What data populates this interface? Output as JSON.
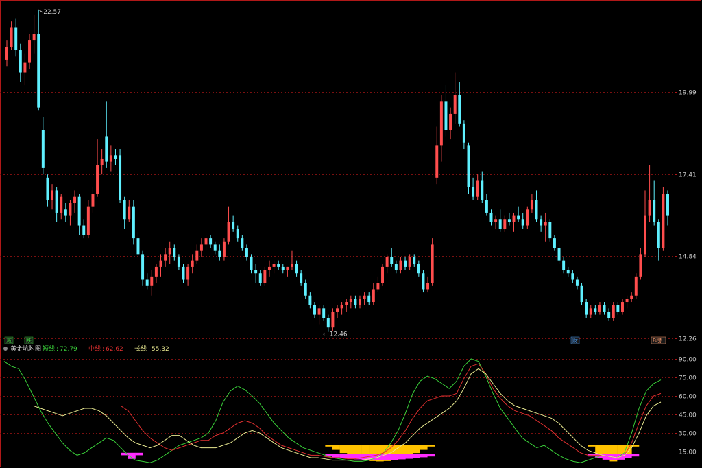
{
  "chart_data": [
    {
      "type": "candlestick",
      "title": "",
      "ylim": [
        12.26,
        22.57
      ],
      "y_ticks": [
        "19.99",
        "17.41",
        "14.84",
        "12.26"
      ],
      "max_label": "22.57",
      "min_label": "12.46",
      "event_marks": [
        "减",
        "跌",
        "财",
        "8榜"
      ],
      "colors": {
        "up": "#ff4d4d",
        "down": "#5ff0ff",
        "grid": "#7a1010",
        "axis": "#b01818"
      },
      "candles": [
        [
          21.0,
          21.6,
          20.8,
          21.4
        ],
        [
          21.4,
          22.2,
          21.3,
          22.0
        ],
        [
          22.0,
          22.3,
          21.1,
          21.3
        ],
        [
          21.3,
          21.5,
          20.3,
          20.6
        ],
        [
          20.6,
          21.2,
          20.2,
          20.9
        ],
        [
          20.9,
          21.8,
          20.7,
          21.6
        ],
        [
          21.6,
          22.4,
          21.2,
          21.8
        ],
        [
          21.8,
          22.57,
          19.4,
          19.5
        ],
        [
          18.8,
          19.2,
          17.4,
          17.6
        ],
        [
          17.3,
          17.4,
          16.4,
          16.6
        ],
        [
          16.6,
          17.1,
          16.3,
          16.9
        ],
        [
          16.9,
          17.0,
          15.9,
          16.2
        ],
        [
          16.2,
          16.8,
          16.0,
          16.7
        ],
        [
          16.3,
          16.5,
          15.9,
          16.1
        ],
        [
          16.1,
          16.6,
          15.8,
          16.5
        ],
        [
          16.5,
          16.9,
          16.2,
          16.7
        ],
        [
          16.7,
          16.8,
          15.5,
          15.8
        ],
        [
          15.8,
          16.0,
          15.4,
          15.5
        ],
        [
          15.5,
          16.6,
          15.4,
          16.4
        ],
        [
          16.4,
          17.0,
          16.2,
          16.8
        ],
        [
          16.8,
          18.5,
          16.7,
          17.7
        ],
        [
          17.7,
          18.2,
          17.4,
          17.9
        ],
        [
          18.6,
          19.7,
          17.6,
          17.8
        ],
        [
          17.8,
          18.3,
          17.5,
          18.0
        ],
        [
          18.0,
          18.2,
          17.7,
          17.9
        ],
        [
          18.0,
          18.2,
          16.5,
          16.6
        ],
        [
          16.6,
          16.7,
          15.7,
          16.0
        ],
        [
          16.0,
          16.6,
          15.9,
          16.4
        ],
        [
          16.4,
          16.6,
          15.2,
          15.4
        ],
        [
          15.4,
          15.6,
          14.8,
          14.9
        ],
        [
          14.9,
          15.0,
          13.9,
          14.1
        ],
        [
          14.1,
          14.3,
          13.8,
          13.9
        ],
        [
          13.9,
          14.4,
          13.6,
          14.2
        ],
        [
          14.2,
          14.6,
          14.0,
          14.5
        ],
        [
          14.5,
          14.9,
          14.2,
          14.7
        ],
        [
          14.7,
          15.1,
          14.5,
          14.9
        ],
        [
          14.9,
          15.3,
          14.6,
          15.1
        ],
        [
          15.1,
          15.2,
          14.7,
          14.8
        ],
        [
          14.8,
          14.9,
          14.4,
          14.5
        ],
        [
          14.5,
          14.6,
          14.0,
          14.1
        ],
        [
          14.1,
          14.6,
          13.9,
          14.5
        ],
        [
          14.5,
          14.9,
          14.3,
          14.7
        ],
        [
          14.7,
          15.2,
          14.6,
          15.0
        ],
        [
          15.0,
          15.4,
          14.8,
          15.2
        ],
        [
          15.2,
          15.5,
          15.0,
          15.4
        ],
        [
          15.4,
          15.5,
          15.1,
          15.2
        ],
        [
          15.2,
          15.3,
          14.9,
          15.0
        ],
        [
          15.0,
          15.2,
          14.7,
          14.8
        ],
        [
          14.8,
          15.4,
          14.7,
          15.3
        ],
        [
          15.3,
          16.4,
          15.2,
          15.9
        ],
        [
          15.9,
          16.1,
          15.6,
          15.7
        ],
        [
          15.7,
          15.8,
          15.3,
          15.4
        ],
        [
          15.4,
          15.5,
          15.0,
          15.1
        ],
        [
          15.1,
          15.2,
          14.7,
          14.8
        ],
        [
          14.8,
          14.9,
          14.3,
          14.4
        ],
        [
          14.4,
          14.6,
          14.0,
          14.3
        ],
        [
          14.3,
          14.4,
          13.9,
          14.0
        ],
        [
          14.0,
          14.5,
          13.9,
          14.4
        ],
        [
          14.4,
          14.7,
          14.2,
          14.5
        ],
        [
          14.5,
          14.7,
          14.3,
          14.6
        ],
        [
          14.6,
          14.7,
          14.4,
          14.5
        ],
        [
          14.5,
          14.6,
          14.3,
          14.4
        ],
        [
          14.4,
          14.5,
          14.2,
          14.5
        ],
        [
          14.5,
          15.0,
          14.4,
          14.6
        ],
        [
          14.6,
          14.7,
          14.2,
          14.3
        ],
        [
          14.3,
          14.4,
          13.9,
          14.0
        ],
        [
          14.0,
          14.1,
          13.5,
          13.6
        ],
        [
          13.6,
          13.7,
          13.2,
          13.3
        ],
        [
          13.3,
          13.4,
          12.9,
          13.0
        ],
        [
          13.0,
          13.3,
          12.7,
          13.2
        ],
        [
          13.2,
          13.3,
          12.8,
          12.9
        ],
        [
          12.9,
          13.0,
          12.46,
          12.6
        ],
        [
          12.6,
          13.2,
          12.5,
          13.1
        ],
        [
          13.1,
          13.3,
          12.9,
          13.2
        ],
        [
          13.2,
          13.4,
          13.0,
          13.3
        ],
        [
          13.3,
          13.5,
          13.1,
          13.4
        ],
        [
          13.4,
          13.6,
          13.2,
          13.5
        ],
        [
          13.5,
          13.6,
          13.2,
          13.3
        ],
        [
          13.3,
          13.6,
          13.2,
          13.5
        ],
        [
          13.5,
          13.7,
          13.3,
          13.6
        ],
        [
          13.6,
          13.7,
          13.3,
          13.4
        ],
        [
          13.4,
          14.0,
          13.3,
          13.8
        ],
        [
          13.8,
          14.2,
          13.7,
          14.0
        ],
        [
          14.0,
          14.6,
          13.9,
          14.5
        ],
        [
          14.5,
          14.9,
          14.3,
          14.8
        ],
        [
          14.8,
          15.1,
          14.5,
          14.6
        ],
        [
          14.6,
          14.7,
          14.3,
          14.4
        ],
        [
          14.4,
          14.8,
          14.3,
          14.7
        ],
        [
          14.7,
          14.8,
          14.4,
          14.5
        ],
        [
          14.5,
          14.9,
          14.4,
          14.8
        ],
        [
          14.8,
          14.9,
          14.5,
          14.6
        ],
        [
          14.6,
          14.7,
          14.2,
          14.3
        ],
        [
          14.3,
          14.4,
          13.7,
          13.8
        ],
        [
          13.8,
          14.2,
          13.7,
          14.0
        ],
        [
          14.0,
          15.4,
          13.9,
          15.2
        ],
        [
          17.3,
          18.9,
          17.1,
          18.3
        ],
        [
          18.3,
          19.9,
          17.8,
          19.7
        ],
        [
          19.7,
          20.2,
          18.6,
          18.8
        ],
        [
          18.8,
          19.5,
          18.5,
          19.3
        ],
        [
          19.3,
          20.6,
          19.0,
          19.9
        ],
        [
          19.9,
          20.3,
          18.9,
          19.0
        ],
        [
          19.0,
          19.1,
          18.2,
          18.4
        ],
        [
          18.3,
          18.4,
          16.8,
          17.0
        ],
        [
          17.0,
          17.3,
          16.6,
          16.7
        ],
        [
          16.7,
          17.4,
          16.6,
          17.2
        ],
        [
          17.2,
          17.5,
          16.5,
          16.6
        ],
        [
          16.6,
          16.8,
          16.1,
          16.2
        ],
        [
          16.2,
          16.3,
          15.8,
          15.9
        ],
        [
          15.9,
          16.1,
          15.7,
          16.0
        ],
        [
          16.0,
          16.3,
          15.6,
          15.7
        ],
        [
          15.7,
          16.1,
          15.6,
          16.0
        ],
        [
          16.0,
          16.2,
          15.8,
          15.9
        ],
        [
          15.9,
          16.2,
          15.6,
          16.1
        ],
        [
          16.1,
          16.4,
          15.9,
          16.0
        ],
        [
          16.0,
          16.2,
          15.7,
          15.8
        ],
        [
          15.8,
          16.4,
          15.7,
          16.3
        ],
        [
          16.3,
          16.8,
          16.2,
          16.6
        ],
        [
          16.6,
          16.9,
          15.9,
          16.0
        ],
        [
          16.0,
          16.1,
          15.6,
          15.8
        ],
        [
          15.8,
          16.2,
          15.3,
          15.9
        ],
        [
          15.9,
          16.0,
          15.3,
          15.4
        ],
        [
          15.4,
          15.5,
          15.0,
          15.1
        ],
        [
          15.1,
          15.2,
          14.6,
          14.7
        ],
        [
          14.7,
          14.8,
          14.3,
          14.4
        ],
        [
          14.4,
          14.5,
          14.2,
          14.3
        ],
        [
          14.3,
          14.4,
          14.0,
          14.1
        ],
        [
          14.1,
          14.2,
          13.8,
          13.9
        ],
        [
          13.9,
          14.0,
          13.3,
          13.4
        ],
        [
          13.4,
          13.5,
          12.9,
          13.0
        ],
        [
          13.0,
          13.3,
          12.9,
          13.2
        ],
        [
          13.2,
          13.3,
          13.0,
          13.1
        ],
        [
          13.1,
          13.4,
          13.0,
          13.3
        ],
        [
          13.3,
          13.4,
          13.0,
          13.1
        ],
        [
          13.1,
          13.2,
          12.8,
          12.9
        ],
        [
          12.9,
          13.4,
          12.8,
          13.3
        ],
        [
          13.3,
          13.4,
          13.0,
          13.1
        ],
        [
          13.1,
          13.5,
          13.0,
          13.4
        ],
        [
          13.4,
          13.6,
          13.2,
          13.5
        ],
        [
          13.5,
          13.7,
          13.4,
          13.6
        ],
        [
          13.6,
          14.3,
          13.5,
          14.2
        ],
        [
          14.2,
          15.1,
          14.1,
          14.9
        ],
        [
          14.9,
          16.9,
          14.8,
          16.1
        ],
        [
          16.1,
          17.7,
          15.9,
          16.6
        ],
        [
          16.6,
          17.2,
          15.8,
          15.9
        ],
        [
          15.9,
          16.0,
          14.7,
          15.1
        ],
        [
          15.1,
          17.0,
          15.0,
          16.8
        ],
        [
          16.8,
          16.9,
          15.8,
          16.1
        ]
      ]
    },
    {
      "type": "line",
      "title": "黄金坑附图",
      "ylim": [
        5,
        95
      ],
      "y_ticks": [
        "90.00",
        "75.00",
        "60.00",
        "45.00",
        "30.00",
        "15.00"
      ],
      "series": [
        {
          "name": "短线",
          "value": "72.79",
          "color": "#3ad13a",
          "values": [
            88,
            84,
            82,
            72,
            60,
            48,
            38,
            30,
            22,
            16,
            12,
            14,
            18,
            22,
            26,
            24,
            18,
            12,
            8,
            7,
            6,
            8,
            12,
            16,
            20,
            22,
            24,
            26,
            30,
            40,
            55,
            64,
            68,
            65,
            60,
            54,
            46,
            38,
            32,
            26,
            22,
            18,
            16,
            14,
            12,
            10,
            9,
            8,
            7,
            7,
            8,
            10,
            14,
            22,
            32,
            46,
            62,
            72,
            76,
            74,
            70,
            66,
            72,
            84,
            90,
            88,
            76,
            62,
            50,
            42,
            34,
            26,
            22,
            18,
            20,
            16,
            12,
            9,
            7,
            6,
            8,
            10,
            12,
            11,
            10,
            14,
            30,
            50,
            64,
            70,
            73
          ]
        },
        {
          "name": "中线",
          "value": "62.62",
          "color": "#e03030",
          "values": [
            null,
            null,
            null,
            null,
            null,
            null,
            null,
            null,
            null,
            null,
            null,
            null,
            null,
            null,
            null,
            null,
            52,
            48,
            40,
            32,
            26,
            22,
            18,
            16,
            18,
            20,
            22,
            24,
            24,
            28,
            30,
            34,
            38,
            40,
            38,
            34,
            28,
            24,
            20,
            18,
            16,
            14,
            12,
            12,
            11,
            10,
            10,
            9,
            9,
            10,
            11,
            12,
            14,
            18,
            24,
            32,
            42,
            50,
            56,
            58,
            60,
            60,
            62,
            74,
            84,
            86,
            78,
            66,
            58,
            52,
            48,
            46,
            44,
            40,
            36,
            32,
            26,
            22,
            18,
            14,
            12,
            12,
            12,
            11,
            10,
            12,
            22,
            38,
            52,
            60,
            62
          ]
        },
        {
          "name": "长线",
          "value": "55.32",
          "color": "#e8e890",
          "values": [
            null,
            null,
            null,
            null,
            52,
            50,
            48,
            46,
            44,
            46,
            48,
            50,
            50,
            48,
            44,
            38,
            32,
            26,
            22,
            20,
            18,
            20,
            24,
            28,
            28,
            24,
            20,
            18,
            18,
            18,
            20,
            22,
            26,
            30,
            32,
            30,
            26,
            22,
            18,
            16,
            14,
            12,
            10,
            10,
            9,
            8,
            8,
            8,
            8,
            8,
            9,
            10,
            12,
            14,
            18,
            22,
            28,
            34,
            38,
            42,
            46,
            50,
            56,
            66,
            78,
            82,
            78,
            70,
            62,
            56,
            52,
            50,
            48,
            46,
            44,
            42,
            38,
            32,
            26,
            20,
            16,
            14,
            12,
            11,
            10,
            12,
            18,
            30,
            44,
            52,
            55
          ]
        }
      ],
      "pits": [
        {
          "from": 16,
          "to": 18,
          "yellow": 0,
          "magenta": 14
        },
        {
          "from": 44,
          "to": 58,
          "yellow": 20,
          "magenta": 13
        },
        {
          "from": 80,
          "to": 86,
          "yellow": 20,
          "magenta": 13
        }
      ]
    }
  ]
}
